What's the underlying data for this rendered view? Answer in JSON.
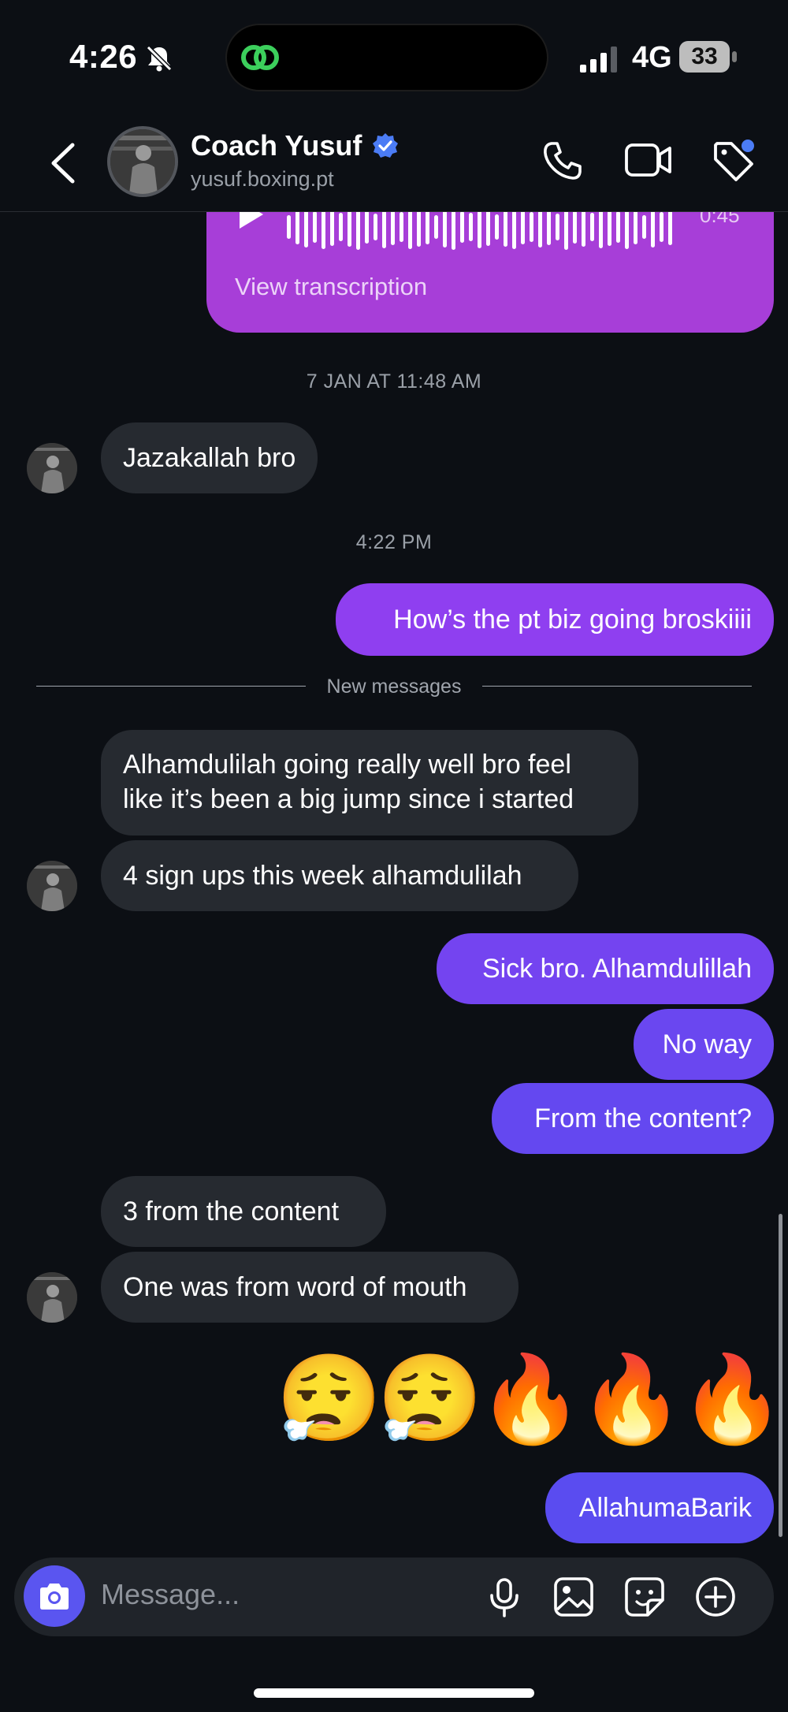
{
  "status_bar": {
    "time": "4:26",
    "network": "4G",
    "battery": "33"
  },
  "header": {
    "contact_name": "Coach Yusuf",
    "handle": "yusuf.boxing.pt"
  },
  "voice_message": {
    "duration": "0:45",
    "transcription_link": "View transcription"
  },
  "timestamps": {
    "t1": "7 JAN AT 11:48 AM",
    "t2": "4:22 PM"
  },
  "divider": {
    "label": "New messages"
  },
  "messages": [
    {
      "from": "them",
      "text": "Jazakallah bro"
    },
    {
      "from": "me",
      "text": "How’s the pt biz going broskiiii"
    },
    {
      "from": "them",
      "text": "Alhamdulilah going really well bro feel like it’s been a big jump since i started"
    },
    {
      "from": "them",
      "text": "4 sign ups this week alhamdulilah"
    },
    {
      "from": "me",
      "text": "Sick bro. Alhamdulillah"
    },
    {
      "from": "me",
      "text": "No way"
    },
    {
      "from": "me",
      "text": "From the content?"
    },
    {
      "from": "them",
      "text": "3 from the content"
    },
    {
      "from": "them",
      "text": "One was from word of mouth"
    },
    {
      "from": "me",
      "text": "AllahumaBarik"
    }
  ],
  "emojis": [
    "😮‍💨",
    "😮‍💨",
    "🔥",
    "🔥",
    "🔥"
  ],
  "composer": {
    "placeholder": "Message..."
  },
  "colors": {
    "background": "#0c0f14",
    "incoming_bubble": "#262a30",
    "outgoing_purple": "#8f3ff0",
    "outgoing_indigo": "#5a4cf0",
    "voice_bubble": "#a73ed8",
    "accent_blue": "#4b7cf5"
  },
  "icons": [
    "bell-slash-icon",
    "link-icon",
    "back-icon",
    "verified-icon",
    "phone-icon",
    "video-icon",
    "tag-icon",
    "play-icon",
    "camera-icon",
    "mic-icon",
    "gallery-icon",
    "sticker-icon",
    "plus-icon"
  ]
}
